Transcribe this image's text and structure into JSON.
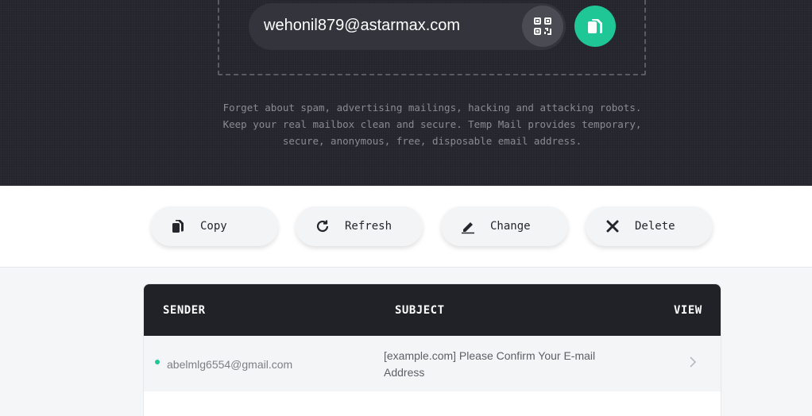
{
  "hero": {
    "email": "wehonil879@astarmax.com",
    "description": "Forget about spam, advertising mailings, hacking and attacking robots. Keep your real mailbox clean and secure. Temp Mail provides temporary, secure, anonymous, free, disposable email address."
  },
  "actions": [
    {
      "label": "Copy",
      "icon": "copy-icon"
    },
    {
      "label": "Refresh",
      "icon": "refresh-icon"
    },
    {
      "label": "Change",
      "icon": "edit-icon"
    },
    {
      "label": "Delete",
      "icon": "close-icon"
    }
  ],
  "inbox": {
    "headers": {
      "sender": "SENDER",
      "subject": "SUBJECT",
      "view": "VIEW"
    },
    "rows": [
      {
        "sender": "abelmlg6554@gmail.com",
        "subject": "[example.com] Please Confirm Your E-mail Address",
        "unread": true
      }
    ]
  },
  "colors": {
    "accent": "#1ec795",
    "dark": "#24252d",
    "table_header": "#202227"
  }
}
